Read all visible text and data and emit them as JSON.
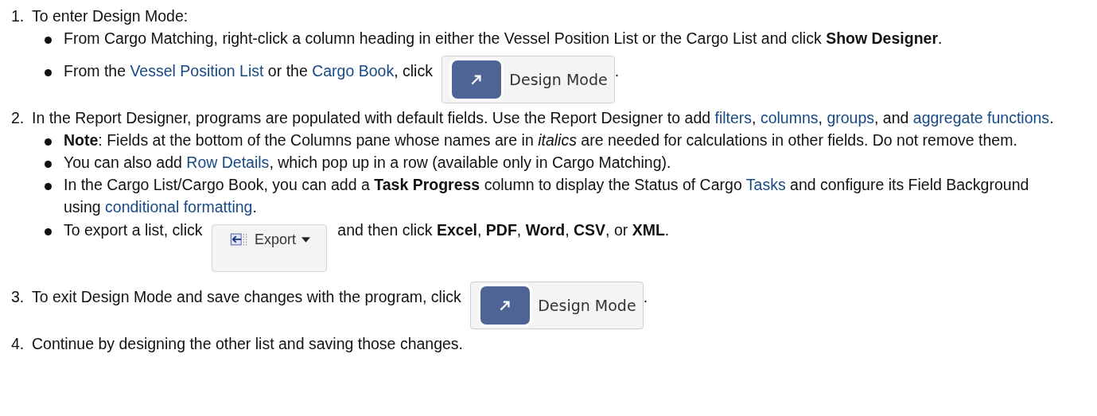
{
  "steps": [
    {
      "number": "1.",
      "text": [
        {
          "kind": "text",
          "text": "To enter Design Mode:"
        }
      ],
      "bullets": [
        [
          {
            "kind": "text",
            "text": "From Cargo Matching, right-click a column heading in either the Vessel Position List or the Cargo List and click **Show Designer**."
          }
        ],
        [
          {
            "kind": "text",
            "text": "From the "
          },
          {
            "kind": "link",
            "text": "Vessel Position List"
          },
          {
            "kind": "text",
            "text": " or the "
          },
          {
            "kind": "link",
            "text": "Cargo Book"
          },
          {
            "kind": "text",
            "text": ", click "
          },
          {
            "kind": "design-mode-button",
            "label": "Design Mode"
          },
          {
            "kind": "text",
            "text": "."
          }
        ]
      ]
    },
    {
      "number": "2.",
      "text": [
        {
          "kind": "text",
          "text": "In the Report Designer, programs are populated with default fields. Use the Report Designer to add "
        },
        {
          "kind": "link",
          "text": "filters"
        },
        {
          "kind": "text",
          "text": ", "
        },
        {
          "kind": "link",
          "text": "columns"
        },
        {
          "kind": "text",
          "text": ", "
        },
        {
          "kind": "link",
          "text": "groups"
        },
        {
          "kind": "text",
          "text": ", and "
        },
        {
          "kind": "link",
          "text": "aggregate functions"
        },
        {
          "kind": "text",
          "text": "."
        }
      ],
      "bullets": [
        [
          {
            "kind": "text",
            "text": "**Note**: Fields at the bottom of the Columns pane whose names are in *italics* are needed for calculations in other fields. Do not remove them."
          }
        ],
        [
          {
            "kind": "text",
            "text": "You can also add "
          },
          {
            "kind": "link",
            "text": "Row Details"
          },
          {
            "kind": "text",
            "text": ", which pop up in a row (available only in Cargo Matching)."
          }
        ],
        [
          {
            "kind": "text",
            "text": "In the Cargo List/Cargo Book, you can add a **Task Progress** column to display the Status of Cargo "
          },
          {
            "kind": "link",
            "text": "Tasks"
          },
          {
            "kind": "text",
            "text": " and configure its Field Background using "
          },
          {
            "kind": "link",
            "text": "conditional formatting"
          },
          {
            "kind": "text",
            "text": "."
          }
        ],
        [
          {
            "kind": "text",
            "text": "To export a list, click "
          },
          {
            "kind": "export-button",
            "label": "Export"
          },
          {
            "kind": "text",
            "text": " and then click **Excel**, **PDF**, **Word**, **CSV**, or **XML**."
          }
        ]
      ]
    },
    {
      "number": "3.",
      "text": [
        {
          "kind": "text",
          "text": "To exit Design Mode and save changes with the program, click "
        },
        {
          "kind": "design-mode-button",
          "label": "Design Mode"
        },
        {
          "kind": "text",
          "text": "."
        }
      ]
    },
    {
      "number": "4.",
      "text": [
        {
          "kind": "text",
          "text": "Continue by designing the other list and saving those changes."
        }
      ]
    }
  ]
}
